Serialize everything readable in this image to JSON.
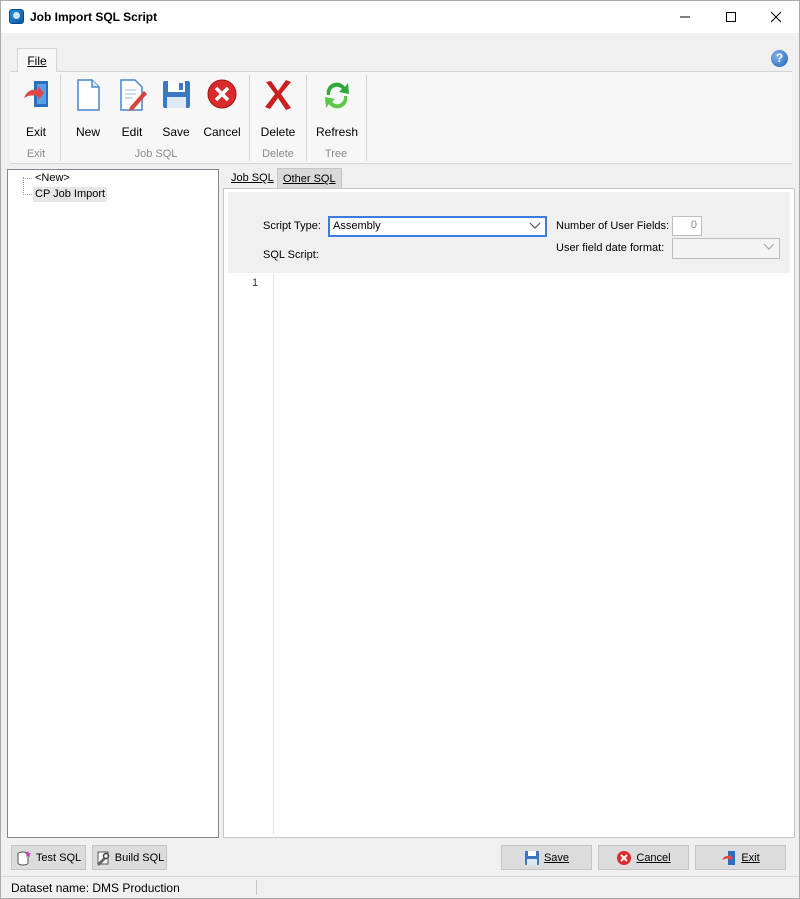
{
  "window": {
    "title": "Job Import SQL Script"
  },
  "ribbon": {
    "tab_file": "File",
    "buttons": {
      "exit": "Exit",
      "new": "New",
      "edit": "Edit",
      "save": "Save",
      "cancel": "Cancel",
      "delete": "Delete",
      "refresh": "Refresh"
    },
    "groups": {
      "exit": "Exit",
      "job_sql": "Job SQL",
      "delete": "Delete",
      "tree": "Tree"
    }
  },
  "tree": {
    "items": [
      "<New>",
      "CP Job Import"
    ]
  },
  "tabs": {
    "job_sql": "Job SQL",
    "other_sql": "Other SQL"
  },
  "form": {
    "script_type_label": "Script Type:",
    "script_type_value": "Assembly",
    "sql_script_label": "SQL Script:",
    "num_user_fields_label": "Number of User Fields:",
    "num_user_fields_value": "0",
    "date_format_label": "User field date format:",
    "date_format_value": ""
  },
  "editor": {
    "line_number": "1"
  },
  "bottom": {
    "test_sql": "Test SQL",
    "build_sql": "Build SQL",
    "save": "Save",
    "cancel": "Cancel",
    "exit": "Exit"
  },
  "status": {
    "dataset": "Dataset name:  DMS Production"
  },
  "colors": {
    "accent": "#3b7ddd",
    "titlebar": "#ffffff",
    "ribbon": "#f7f7f7"
  }
}
